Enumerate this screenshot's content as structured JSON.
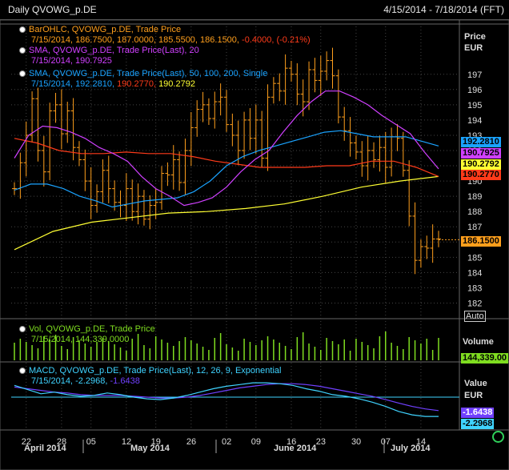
{
  "header": {
    "title": "Daily QVOWG_p.DE",
    "date_range": "4/15/2014 - 7/18/2014 (FFT)"
  },
  "legend": {
    "bar": {
      "line1": "BarOHLC, QVOWG_p.DE, Trade Price",
      "line2_date": "7/15/2014,",
      "line2_vals": "186.7500, 187.0000, 185.5500, 186.1500,",
      "line2_chg": "-0.4000, (-0.21%)"
    },
    "sma20": {
      "line1": "SMA, QVOWG_p.DE, Trade Price(Last), 20",
      "line2": "7/15/2014, 190.7925"
    },
    "sma_multi": {
      "line1": "SMA, QVOWG_p.DE, Trade Price(Last), 50, 100, 200, Single",
      "line2_date": "7/15/2014,",
      "v50": "192.2810,",
      "v100": "190.2770,",
      "v200": "190.2792"
    },
    "vol": {
      "line1": "Vol, QVOWG_p.DE, Trade Price",
      "line2": "7/15/2014, 144,339.0000"
    },
    "macd": {
      "line1": "MACD, QVOWG_p.DE, Trade Price(Last), 12, 26, 9, Exponential",
      "line2_date": "7/15/2014,",
      "v1": "-2.2968,",
      "v2": "-1.6438"
    }
  },
  "price_axis": {
    "title": "Price",
    "unit": "EUR",
    "ticks": [
      "197",
      "196",
      "195",
      "194",
      "193",
      "192",
      "191",
      "190",
      "189",
      "188",
      "187",
      "186",
      "185",
      "184",
      "183",
      "182"
    ],
    "auto_label": "Auto"
  },
  "volume_axis": {
    "title": "Volume",
    "value": "144,339.00"
  },
  "macd_axis": {
    "title": "Value",
    "unit": "EUR",
    "v_signal": "-1.6438",
    "v_macd": "-2.2968"
  },
  "price_tags": {
    "sma50": "192.2810",
    "sma20": "190.7925",
    "sma200": "190.2792",
    "sma100": "190.2770",
    "last": "186.1500"
  },
  "x_axis": {
    "days": [
      "22",
      "28",
      "05",
      "12",
      "19",
      "26",
      "02",
      "09",
      "16",
      "23",
      "30",
      "07",
      "14"
    ],
    "months": [
      "April 2014",
      "May 2014",
      "June 2014",
      "July 2014"
    ]
  },
  "colors": {
    "bars": "#ff9f1c",
    "sma20": "#d040ff",
    "sma50": "#1aa3ff",
    "sma100": "#ff3b1a",
    "sma200": "#ffff33",
    "vol": "#7fdd20",
    "macd": "#3fd3ff",
    "signal": "#7040ff",
    "grid": "#444444",
    "last": "#ff9f1c"
  },
  "chart_data": {
    "type": "ohlc",
    "title": "Daily QVOWG_p.DE",
    "ylim": [
      181.5,
      198.3
    ],
    "last_bar": {
      "date": "7/15/2014",
      "open": 186.75,
      "high": 187.0,
      "low": 185.55,
      "close": 186.15
    },
    "closes": [
      189.5,
      191.2,
      193.0,
      195.4,
      192.0,
      190.6,
      194.6,
      195.0,
      193.1,
      194.6,
      192.2,
      191.4,
      190.0,
      188.4,
      189.3,
      190.7,
      189.5,
      188.6,
      188.4,
      189.5,
      188.0,
      189.0,
      187.5,
      188.4,
      188.6,
      190.5,
      190.4,
      191.4,
      189.9,
      192.0,
      193.5,
      194.7,
      195.0,
      194.1,
      195.2,
      195.5,
      193.7,
      193.0,
      192.0,
      194.0,
      192.8,
      194.0,
      191.5,
      195.5,
      196.4,
      195.9,
      197.4,
      197.0,
      195.7,
      195.2,
      197.3,
      196.6,
      197.2,
      197.9,
      196.9,
      194.2,
      193.3,
      192.5,
      191.9,
      191.0,
      192.0,
      191.4,
      192.2,
      190.9,
      192.9,
      192.8,
      190.7,
      187.7,
      184.8,
      185.7,
      185.6,
      186.2,
      186.2
    ],
    "series": [
      {
        "name": "SMA 20",
        "values": [
          191.5,
          193.0,
          193.6,
          193.5,
          193.2,
          192.8,
          192.2,
          191.8,
          191.3,
          190.3,
          189.5,
          189.0,
          188.4,
          188.6,
          188.9,
          189.6,
          190.6,
          191.4,
          192.0,
          193.2,
          194.3,
          195.2,
          195.9,
          195.9,
          195.5,
          195.0,
          194.3,
          193.7,
          193.1,
          191.9,
          190.8
        ]
      },
      {
        "name": "SMA 50",
        "values": [
          189.4,
          189.8,
          189.8,
          189.5,
          189.0,
          188.7,
          188.3,
          188.5,
          188.7,
          188.8,
          188.9,
          189.3,
          190.0,
          191.0,
          191.6,
          192.0,
          192.3,
          192.6,
          192.9,
          193.2,
          193.3,
          193.1,
          192.9,
          192.9,
          192.9,
          192.6,
          192.3
        ]
      },
      {
        "name": "SMA 100",
        "values": [
          192.8,
          192.5,
          192.0,
          191.8,
          191.8,
          191.9,
          191.8,
          191.8,
          191.6,
          191.3,
          191.1,
          190.9,
          190.9,
          190.9,
          191.0,
          191.0,
          191.3,
          191.3,
          190.9,
          190.3
        ]
      },
      {
        "name": "SMA 200",
        "values": [
          185.5,
          186.7,
          187.3,
          187.6,
          187.9,
          188.0,
          188.2,
          188.5,
          189.0,
          189.6,
          190.0,
          190.3
        ]
      },
      {
        "name": "Vol",
        "last": 144339
      },
      {
        "name": "MACD",
        "last": -2.2968
      },
      {
        "name": "Signal",
        "last": -1.6438
      }
    ]
  }
}
